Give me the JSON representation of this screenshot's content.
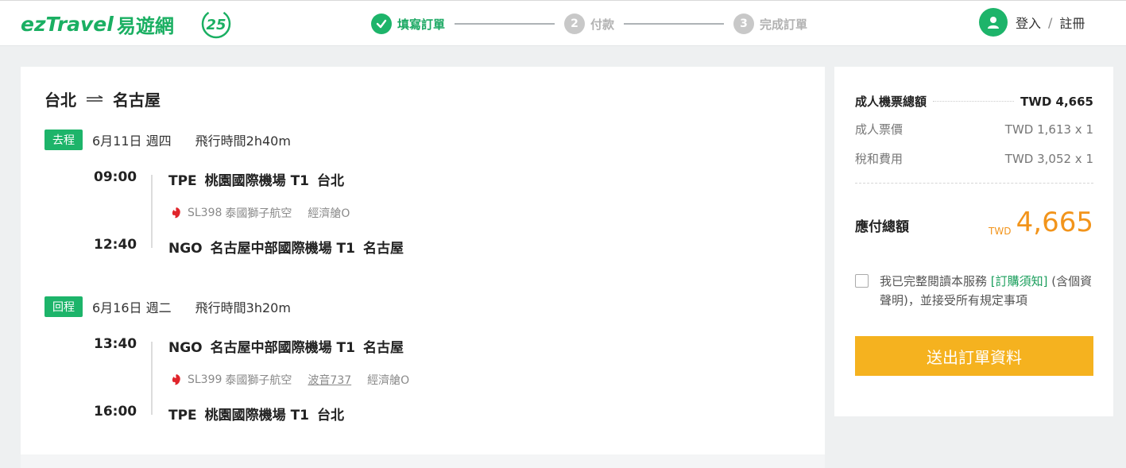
{
  "header": {
    "logo_en": "ezTravel",
    "logo_zh": "易遊網",
    "logo_badge": "25",
    "steps": [
      {
        "num": "✓",
        "label": "填寫訂單",
        "state": "done"
      },
      {
        "num": "2",
        "label": "付款",
        "state": "todo"
      },
      {
        "num": "3",
        "label": "完成訂單",
        "state": "todo"
      }
    ],
    "login": "登入",
    "separator": "/",
    "register": "註冊"
  },
  "trip": {
    "origin": "台北",
    "destination": "名古屋",
    "outbound": {
      "tag": "去程",
      "date": "6月11日 週四",
      "duration": "飛行時間2h40m",
      "dep_time": "09:00",
      "dep_code": "TPE",
      "dep_airport": "桃園國際機場 T1",
      "dep_city": "台北",
      "flight_no": "SL398",
      "airline": "泰國獅子航空",
      "cabin": "經濟艙O",
      "arr_time": "12:40",
      "arr_code": "NGO",
      "arr_airport": "名古屋中部國際機場 T1",
      "arr_city": "名古屋"
    },
    "inbound": {
      "tag": "回程",
      "date": "6月16日 週二",
      "duration": "飛行時間3h20m",
      "dep_time": "13:40",
      "dep_code": "NGO",
      "dep_airport": "名古屋中部國際機場 T1",
      "dep_city": "名古屋",
      "flight_no": "SL399",
      "airline": "泰國獅子航空",
      "aircraft": "波音737",
      "cabin": "經濟艙O",
      "arr_time": "16:00",
      "arr_code": "TPE",
      "arr_airport": "桃園國際機場 T1",
      "arr_city": "台北"
    }
  },
  "summary": {
    "total_label": "成人機票總額",
    "total_value": "TWD 4,665",
    "fare_label": "成人票價",
    "fare_value": "TWD 1,613 x 1",
    "tax_label": "稅和費用",
    "tax_value": "TWD 3,052 x 1",
    "payable_label": "應付總額",
    "payable_currency": "TWD",
    "payable_amount": "4,665",
    "agree_pre": "我已完整閱讀本服務 ",
    "agree_link": "[訂購須知]",
    "agree_post": " (含個資聲明)，並接受所有規定事項",
    "submit_label": "送出訂單資料"
  },
  "colors": {
    "brand_green": "#1db46a",
    "accent_orange": "#f2941b",
    "button_yellow": "#f5b21f"
  }
}
